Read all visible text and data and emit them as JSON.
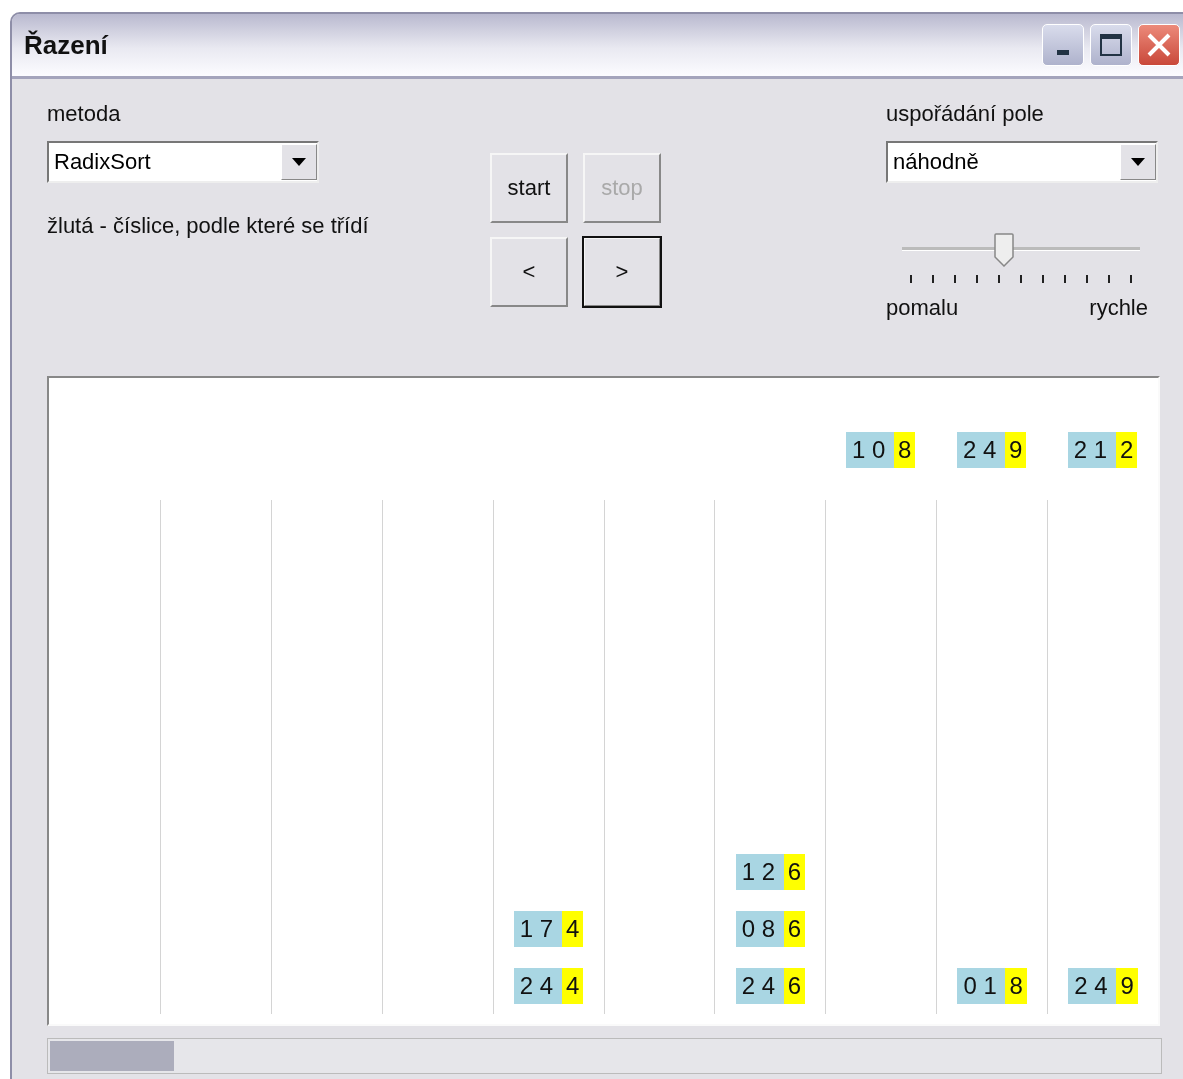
{
  "window": {
    "title": "Řazení"
  },
  "method": {
    "label": "metoda",
    "value": "RadixSort",
    "hint": "žlutá - číslice, podle které se třídí"
  },
  "buttons": [
    {
      "label": "start",
      "disabled": false,
      "focused": false
    },
    {
      "label": "stop",
      "disabled": true,
      "focused": false
    },
    {
      "label": "<",
      "disabled": false,
      "focused": false
    },
    {
      "label": ">",
      "disabled": false,
      "focused": true
    }
  ],
  "arrangement": {
    "label": "uspořádání pole",
    "value": "náhodně"
  },
  "speed": {
    "level": 0.43,
    "min_label": "pomalu",
    "max_label": "rychle"
  },
  "queue": [
    {
      "prefix": "1 0",
      "key": "8"
    },
    {
      "prefix": "2 4",
      "key": "9"
    },
    {
      "prefix": "2 1",
      "key": "2"
    }
  ],
  "bucketed": [
    {
      "prefix": "1 7",
      "key": "4"
    },
    {
      "prefix": "2 4",
      "key": "4"
    },
    {
      "prefix": "1 2",
      "key": "6"
    },
    {
      "prefix": "0 8",
      "key": "6"
    },
    {
      "prefix": "2 4",
      "key": "6"
    },
    {
      "prefix": "0 1",
      "key": "8"
    },
    {
      "prefix": "2 4",
      "key": "9"
    }
  ]
}
